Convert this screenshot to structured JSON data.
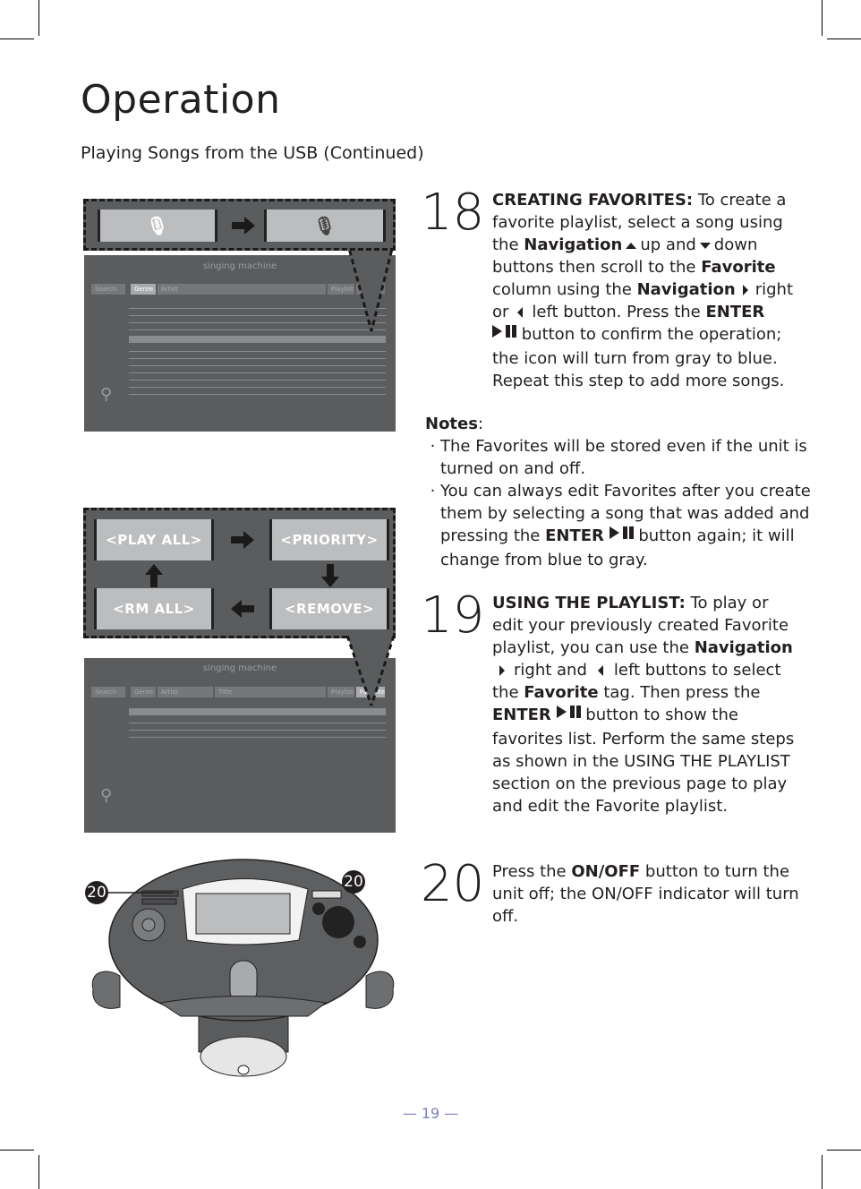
{
  "page": {
    "title": "Operation",
    "subtitle": "Playing Songs from the USB (Continued)",
    "page_number": "— 19 —",
    "accent_color": "#7b7fc0"
  },
  "step18": {
    "number": "18",
    "l1b": "CREATING FAVORITES:",
    "l1": " To create a",
    "l2": "favorite playlist, select a song using",
    "l3a": "the ",
    "l3b": "Navigation",
    "l3c": "up and",
    "l3d": "down",
    "l4a": "buttons then scroll to the ",
    "l4b": "Favorite",
    "l5a": "column using the ",
    "l5b": "Navigation",
    "l5c": "right",
    "l6a": "or",
    "l6b": "left button. Press the ",
    "l6c": "ENTER",
    "l7": "button to confirm the operation;",
    "l8": "the icon will turn from gray to blue.",
    "l9": "Repeat this step to add more songs."
  },
  "notes": {
    "heading": "Notes",
    "colon": ":",
    "n1a": "The Favorites will be stored even if the unit is",
    "n1b": "turned on and off.",
    "n2a": "You can always edit Favorites after you create",
    "n2b": "them by selecting a song that was added and",
    "n2c1": "pressing the ",
    "n2c2": "ENTER",
    "n2c3": "button again; it will",
    "n2d": "change from blue to gray.",
    "bullet": "·"
  },
  "step19": {
    "number": "19",
    "l1b": "USING THE PLAYLIST:",
    "l1": " To play or",
    "l2": "edit your previously created Favorite",
    "l3a": "playlist, you can use the ",
    "l3b": "Navigation",
    "l4a": "right and",
    "l4b": "left buttons to select",
    "l5a": "the ",
    "l5b": "Favorite",
    "l5c": " tag. Then press the",
    "l6a": "ENTER",
    "l6b": "button to show the",
    "l7": "favorites list. Perform the same steps",
    "l8": "as shown in the USING THE PLAYLIST",
    "l9": "section on the previous page to play",
    "l10": "and edit the Favorite playlist."
  },
  "step20": {
    "number": "20",
    "l1a": "Press the ",
    "l1b": "ON/OFF",
    "l1c": " button to turn the",
    "l2": "unit off; the ON/OFF indicator will turn",
    "l3": "off."
  },
  "figure1": {
    "brand": "singing machine",
    "headers": [
      "Search",
      "Genre",
      "Artist",
      "Playlist"
    ]
  },
  "figure2": {
    "buttons": {
      "play_all": "<PLAY ALL>",
      "priority": "<PRIORITY>",
      "rm_all": "<RM ALL>",
      "remove": "<REMOVE>"
    },
    "brand": "singing machine",
    "headers": [
      "Search",
      "Genre",
      "Artist",
      "Title",
      "Playlist",
      "Favorite"
    ]
  },
  "figure3": {
    "callout_left": "20",
    "callout_right": "20"
  }
}
